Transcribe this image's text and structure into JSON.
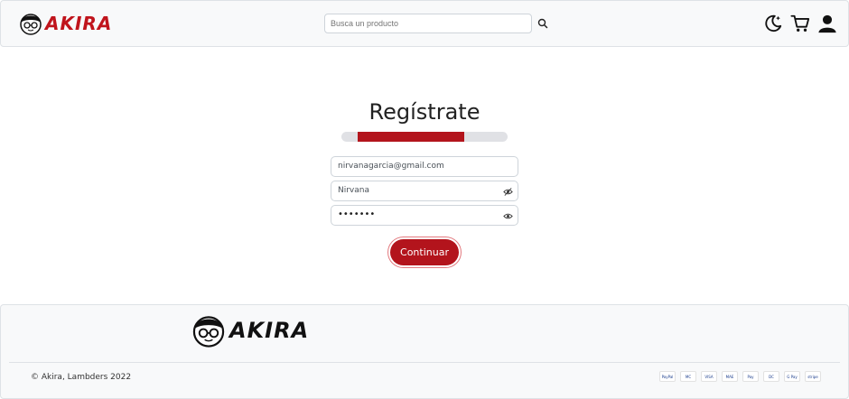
{
  "header": {
    "brand": "AKIRA",
    "search_placeholder": "Busca un producto",
    "icons": [
      "moon-star-icon",
      "cart-icon",
      "user-icon"
    ]
  },
  "main": {
    "title": "Regístrate",
    "progress_percent": 50,
    "email_value": "nirvanagarcia@gmail.com",
    "name_value": "Nirvana",
    "password_value": "•••••••",
    "continue_label": "Continuar"
  },
  "footer": {
    "brand": "AKIRA",
    "copyright": "© Akira, Lambders 2022",
    "payment_methods": [
      {
        "icon": "paypal-icon",
        "label": "PayPal"
      },
      {
        "icon": "mastercard-icon",
        "label": "MC"
      },
      {
        "icon": "visa-icon",
        "label": "VISA"
      },
      {
        "icon": "maestro-icon",
        "label": "MAE"
      },
      {
        "icon": "apple-pay-icon",
        "label": "Pay"
      },
      {
        "icon": "diners-icon",
        "label": "DC"
      },
      {
        "icon": "google-pay-icon",
        "label": "G Pay"
      },
      {
        "icon": "stripe-icon",
        "label": "stripe"
      }
    ]
  },
  "colors": {
    "accent": "#b3141c",
    "brand_red": "#c0141c",
    "background": "#f8f9fa"
  }
}
